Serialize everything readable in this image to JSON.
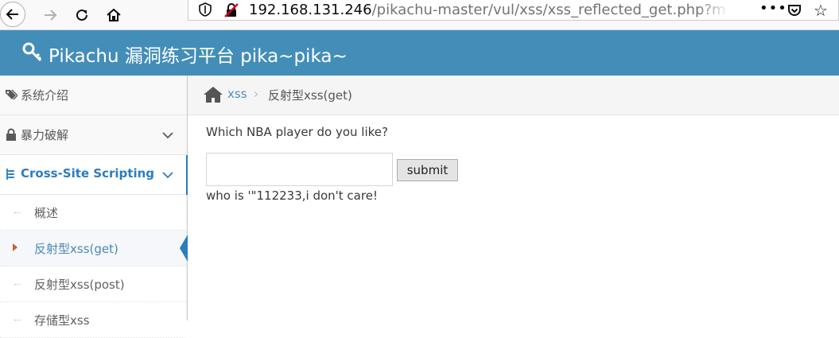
{
  "browser": {
    "url_host": "192.168.131.246",
    "url_path": "/pikachu-master/vul/xss/xss_reflected_get.php?message",
    "more_label": "•••"
  },
  "app": {
    "title": "Pikachu 漏洞练习平台 pika~pika~"
  },
  "sidebar": {
    "items": [
      {
        "label": "系统介绍"
      },
      {
        "label": "暴力破解"
      },
      {
        "label": "Cross-Site Scripting"
      }
    ],
    "subitems": [
      {
        "label": "概述"
      },
      {
        "label": "反射型xss(get)"
      },
      {
        "label": "反射型xss(post)"
      },
      {
        "label": "存储型xss"
      }
    ]
  },
  "breadcrumb": {
    "link": "xss",
    "separator": "›",
    "current": "反射型xss(get)"
  },
  "main": {
    "question": "Which NBA player do you like?",
    "input_value": "",
    "submit_label": "submit",
    "result": "who is '\"112233,i don't care!"
  },
  "colors": {
    "header_bg": "#438eb9",
    "link": "#4c8fbd",
    "active_group": "#2b7dbc",
    "active_caret": "#c86139"
  }
}
